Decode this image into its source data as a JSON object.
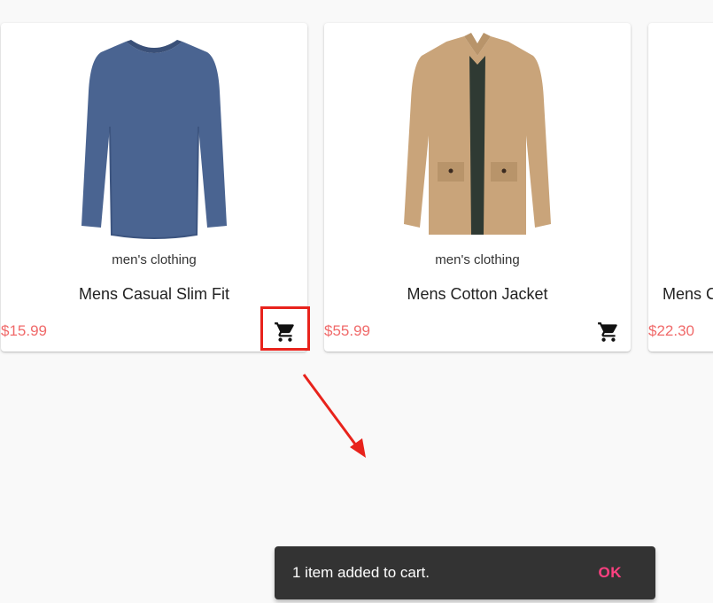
{
  "products": [
    {
      "category": "men's clothing",
      "title": "Mens Casual Slim Fit",
      "price": "$15.99",
      "image_icon": "blue-long-sleeve-shirt-image"
    },
    {
      "category": "men's clothing",
      "title": "Mens Cotton Jacket",
      "price": "$55.99",
      "image_icon": "khaki-cotton-jacket-image"
    },
    {
      "category": "",
      "title": "Mens C",
      "price": "$22.30",
      "image_icon": ""
    }
  ],
  "cart_icon": "shopping-cart-icon",
  "snackbar": {
    "message": "1 item added to cart.",
    "action_label": "OK"
  },
  "colors": {
    "price": "#f06a6a",
    "snackbar_background": "#333333",
    "snackbar_action": "#ff4081",
    "annotation": "#e8231c",
    "shirt": "#4a6491",
    "jacket": "#c9a47a"
  }
}
